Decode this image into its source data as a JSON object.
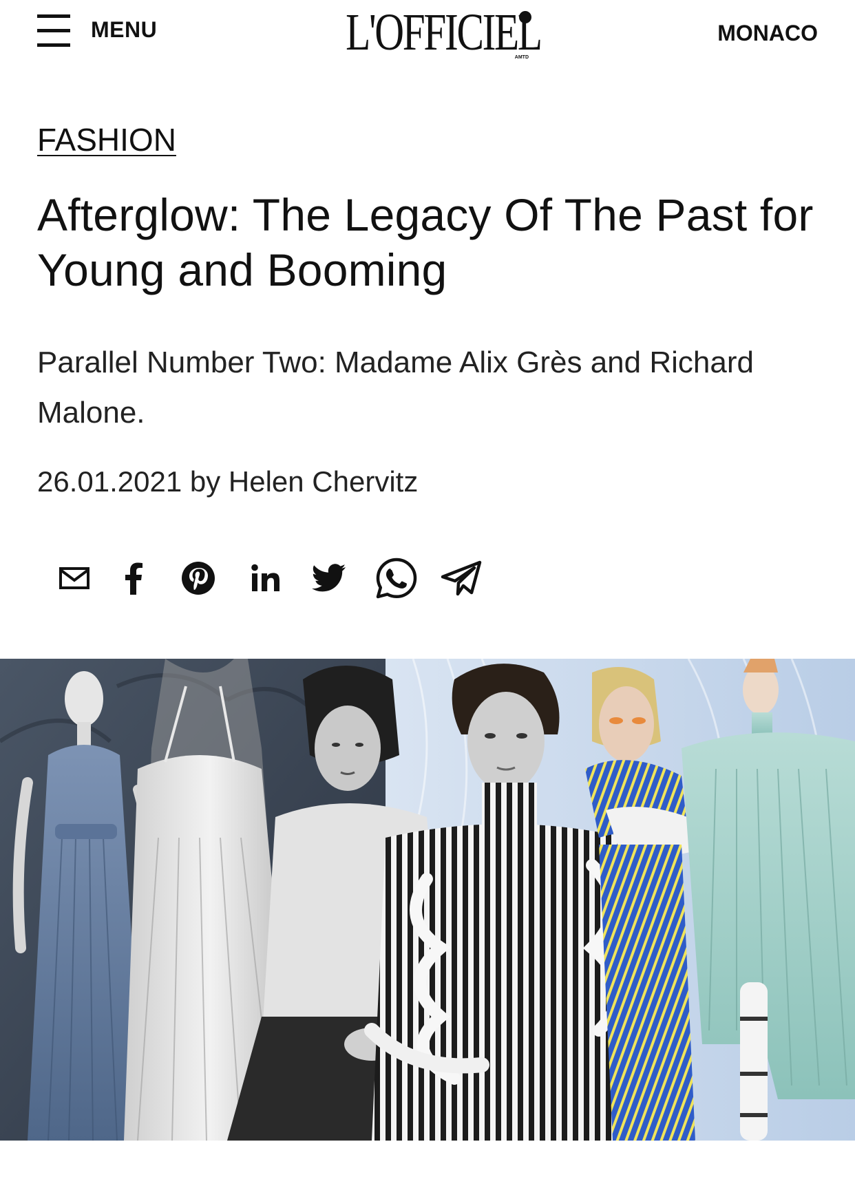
{
  "header": {
    "menu_label": "MENU",
    "logo_text": "L'OFFICIEL",
    "logo_sub": "AMTD",
    "region": "MONACO"
  },
  "article": {
    "category": "FASHION",
    "title": "Afterglow: The Legacy Of The Past for Young and Booming",
    "subtitle": "Parallel Number Two: Madame Alix Grès and Richard Malone.",
    "byline": "26.01.2021 by Helen Chervitz"
  },
  "share_icons": [
    "mail-icon",
    "facebook-icon",
    "pinterest-icon",
    "linkedin-icon",
    "twitter-icon",
    "whatsapp-icon",
    "telegram-icon"
  ],
  "colors": {
    "text": "#111111",
    "background": "#ffffff"
  }
}
